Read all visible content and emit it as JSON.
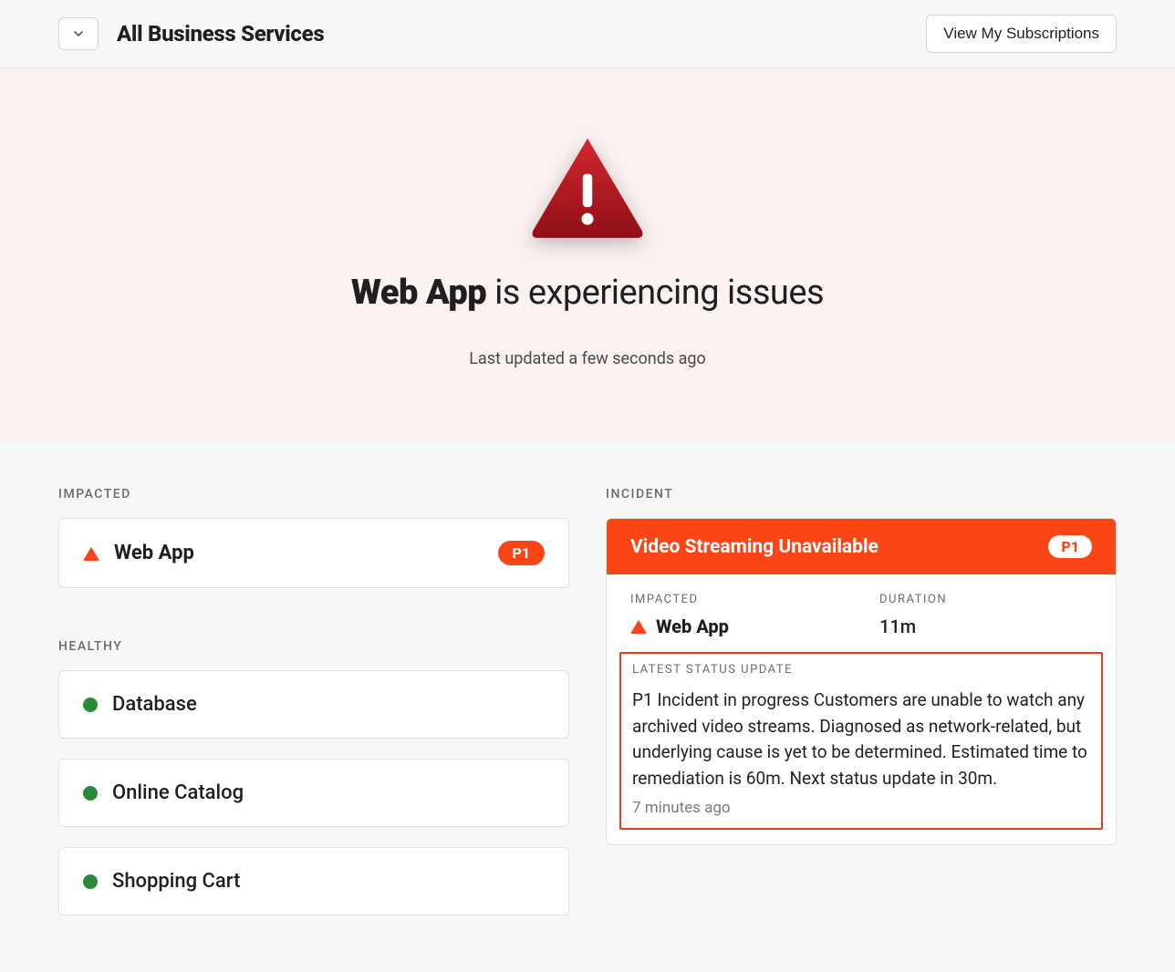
{
  "header": {
    "title": "All Business Services",
    "subscriptions_label": "View My Subscriptions"
  },
  "hero": {
    "service_bold": "Web App",
    "suffix": " is experiencing issues",
    "last_updated": "Last updated a few seconds ago"
  },
  "labels": {
    "impacted": "IMPACTED",
    "healthy": "HEALTHY",
    "incident": "INCIDENT",
    "latest_status": "LATEST STATUS UPDATE",
    "duration": "DURATION"
  },
  "impacted": [
    {
      "name": "Web App",
      "priority": "P1"
    }
  ],
  "healthy": [
    {
      "name": "Database"
    },
    {
      "name": "Online Catalog"
    },
    {
      "name": "Shopping Cart"
    }
  ],
  "incident": {
    "title": "Video Streaming Unavailable",
    "priority": "P1",
    "impacted_label": "IMPACTED",
    "impacted_service": "Web App",
    "duration": "11m",
    "status_text": "P1 Incident in progress Customers are unable to watch any archived video streams. Diagnosed as network-related, but underlying cause is yet to be determined. Estimated time to remediation is 60m. Next status update in 30m.",
    "status_time": "7 minutes ago"
  },
  "colors": {
    "accent": "#fa4616",
    "healthy": "#2a8a3a",
    "warn": "#a41219"
  }
}
